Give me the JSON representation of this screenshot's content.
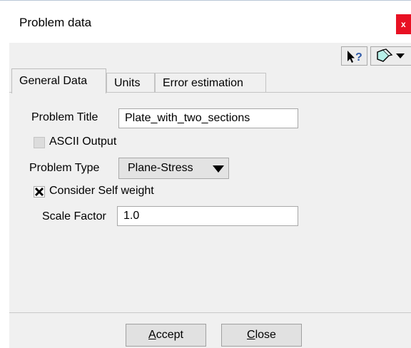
{
  "window": {
    "title": "Problem data",
    "close_glyph": "x"
  },
  "toolbar": {
    "help_icon": "whats-this-help-icon",
    "help_glyph": "?",
    "options_icon": "eraser-menu-icon"
  },
  "tabs": [
    {
      "label": "General Data",
      "active": true
    },
    {
      "label": "Units",
      "active": false
    },
    {
      "label": "Error estimation",
      "active": false
    }
  ],
  "form": {
    "problem_title_label": "Problem Title",
    "problem_title_value": "Plate_with_two_sections",
    "ascii_output_label": "ASCII Output",
    "ascii_output_checked": false,
    "problem_type_label": "Problem Type",
    "problem_type_value": "Plane-Stress",
    "self_weight_label": "Consider Self weight",
    "self_weight_checked": true,
    "scale_factor_label": "Scale Factor",
    "scale_factor_value": "1.0"
  },
  "buttons": {
    "accept": "Accept",
    "close": "Close"
  },
  "colors": {
    "close_red": "#e81123",
    "dialog_bg": "#f0f0f0"
  }
}
